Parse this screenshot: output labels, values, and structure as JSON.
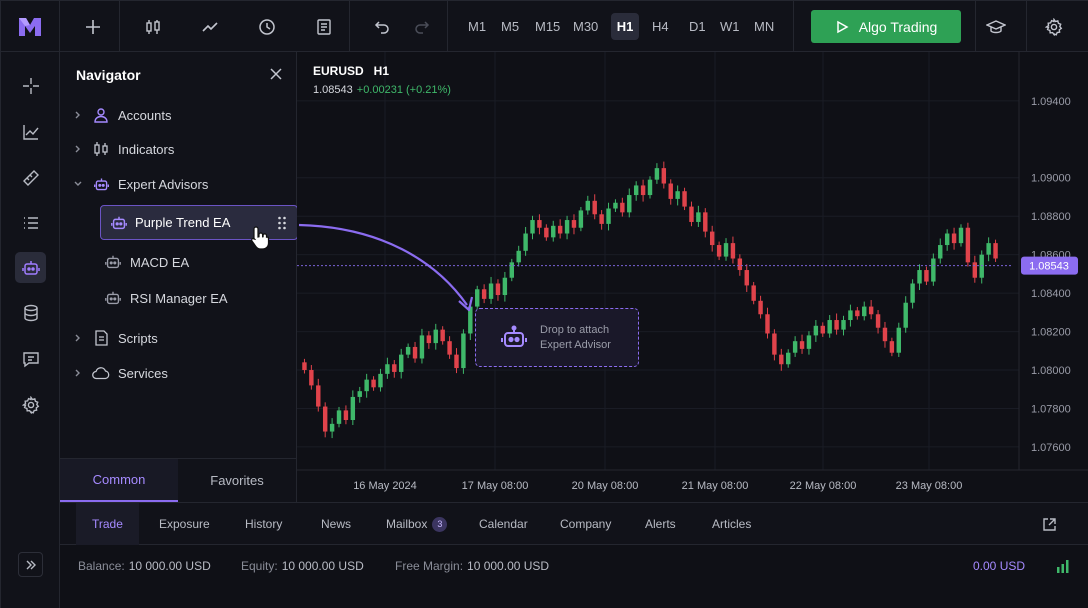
{
  "colors": {
    "accent": "#8b6cf0",
    "green": "#2ea155",
    "up": "#3fb86a",
    "down": "#e0434b",
    "price_tag": "#8b6cf0"
  },
  "toolbar": {
    "icons": [
      "plus-icon",
      "candlestick-icon",
      "line-chart-icon",
      "clock-icon",
      "document-icon",
      "undo-icon",
      "redo-icon",
      "graduation-cap-icon",
      "gear-icon"
    ],
    "timeframes": [
      "M1",
      "M5",
      "M15",
      "M30",
      "H1",
      "H4",
      "D1",
      "W1",
      "MN"
    ],
    "active_timeframe": "H1",
    "algo_trading_label": "Algo Trading"
  },
  "rail": {
    "icons": [
      "crosshair-icon",
      "trend-icon",
      "ruler-icon",
      "list-icon",
      "robot-icon",
      "database-icon",
      "chat-icon",
      "settings-icon",
      "expand-icon"
    ],
    "active": "robot-icon"
  },
  "navigator": {
    "title": "Navigator",
    "items": [
      {
        "label": "Accounts",
        "icon": "user-icon"
      },
      {
        "label": "Indicators",
        "icon": "candles-icon"
      },
      {
        "label": "Expert Advisors",
        "icon": "robot-icon"
      },
      {
        "label": "Scripts",
        "icon": "script-icon"
      },
      {
        "label": "Services",
        "icon": "cloud-icon"
      }
    ],
    "experts": [
      {
        "label": "Purple Trend EA",
        "selected": true
      },
      {
        "label": "MACD EA"
      },
      {
        "label": "RSI Manager EA"
      }
    ],
    "tabs": {
      "common": "Common",
      "favorites": "Favorites",
      "active": "Common"
    }
  },
  "chart": {
    "symbol": "EURUSD",
    "timeframe": "H1",
    "price": "1.08543",
    "change": "+0.00231 (+0.21%)",
    "current_price_tag": "1.08543",
    "drop_zone": {
      "line1": "Drop to attach",
      "line2": "Expert Advisor"
    }
  },
  "chart_data": {
    "type": "candlestick",
    "y_ticks": [
      "1.09400",
      "1.09000",
      "1.08800",
      "1.08600",
      "1.08400",
      "1.08200",
      "1.08000",
      "1.07800",
      "1.07600"
    ],
    "x_ticks": [
      "16 May 2024",
      "17 May 08:00",
      "20 May 08:00",
      "21 May 08:00",
      "22 May 08:00",
      "23 May 08:00"
    ],
    "ylim": [
      1.0748,
      1.0955
    ],
    "current_price": 1.08543,
    "close": [
      1.08,
      1.0792,
      1.0781,
      1.0768,
      1.0772,
      1.0779,
      1.0774,
      1.0786,
      1.0789,
      1.0795,
      1.0791,
      1.0798,
      1.0803,
      1.0799,
      1.0808,
      1.0812,
      1.0806,
      1.0818,
      1.0814,
      1.0821,
      1.0815,
      1.0808,
      1.0801,
      1.0819,
      1.0833,
      1.0842,
      1.0837,
      1.0845,
      1.0839,
      1.0848,
      1.0856,
      1.0862,
      1.0871,
      1.0878,
      1.0874,
      1.0869,
      1.0875,
      1.0871,
      1.0878,
      1.0874,
      1.0883,
      1.0888,
      1.0881,
      1.0876,
      1.0884,
      1.0887,
      1.0882,
      1.0891,
      1.0896,
      1.0891,
      1.0899,
      1.0905,
      1.0897,
      1.0889,
      1.0893,
      1.0885,
      1.0877,
      1.0882,
      1.0872,
      1.0865,
      1.0859,
      1.0866,
      1.0858,
      1.0852,
      1.0844,
      1.0836,
      1.0829,
      1.0819,
      1.0808,
      1.0803,
      1.0809,
      1.0815,
      1.0811,
      1.0818,
      1.0823,
      1.0819,
      1.0826,
      1.0821,
      1.0826,
      1.0831,
      1.0828,
      1.0833,
      1.0829,
      1.0822,
      1.0815,
      1.0809,
      1.0822,
      1.0835,
      1.0845,
      1.0852,
      1.0846,
      1.0858,
      1.0865,
      1.0871,
      1.0866,
      1.0874,
      1.0856,
      1.0848,
      1.086,
      1.0866,
      1.0858
    ],
    "series_style": "green up / red down"
  },
  "bottom_tabs": [
    {
      "label": "Trade"
    },
    {
      "label": "Exposure"
    },
    {
      "label": "History"
    },
    {
      "label": "News"
    },
    {
      "label": "Mailbox",
      "badge": "3"
    },
    {
      "label": "Calendar"
    },
    {
      "label": "Company"
    },
    {
      "label": "Alerts"
    },
    {
      "label": "Articles"
    }
  ],
  "status": {
    "balance_label": "Balance:",
    "balance": "10 000.00 USD",
    "equity_label": "Equity:",
    "equity": "10 000.00 USD",
    "free_margin_label": "Free Margin:",
    "free_margin": "10 000.00 USD",
    "pl": "0.00 USD"
  }
}
